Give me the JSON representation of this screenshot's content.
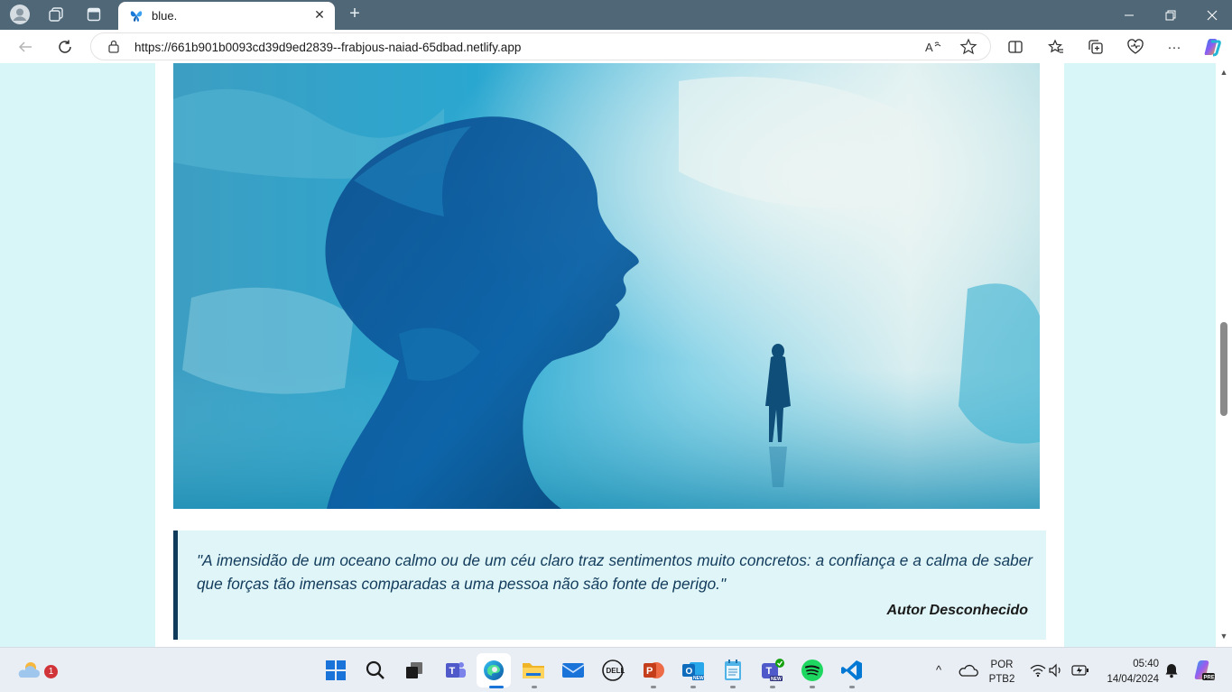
{
  "browser": {
    "tab": {
      "title": "blue.",
      "close": "✕"
    },
    "new_tab": "+",
    "window_controls": {
      "minimize": "—",
      "restore": "❐",
      "close": "✕"
    },
    "address": {
      "url": "https://661b901b0093cd39d9ed2839--frabjous-naiad-65dbad.netlify.app"
    },
    "nav": {
      "back": "←",
      "refresh": "↻",
      "more": "···"
    }
  },
  "page": {
    "hero_image": {
      "subject": "blue watercolor silhouette of a face with a small standing figure"
    },
    "quote": {
      "text": "\"A imensidão de um oceano calmo ou de um céu claro traz sentimentos muito concretos: a confiança e a calma de saber que forças tão imensas comparadas a uma pessoa não são fonte de perigo.\"",
      "author": "Autor Desconhecido"
    },
    "colors": {
      "page_bg": "#d8f5f7",
      "card_bg": "#ffffff",
      "quote_bg": "#dff5f7",
      "quote_border": "#0e3a5c",
      "quote_text": "#123b5c"
    }
  },
  "scrollbar": {
    "up": "▲",
    "down": "▼",
    "position": 0.48
  },
  "taskbar": {
    "weather_badge": "1",
    "apps": [
      "start",
      "search",
      "task-view",
      "teams",
      "edge",
      "file-explorer",
      "mail",
      "dell",
      "powerpoint",
      "outlook-new",
      "notepad",
      "teams-new",
      "spotify",
      "vscode"
    ],
    "tray": {
      "language_top": "POR",
      "language_bottom": "PTB2",
      "time": "05:40",
      "date": "14/04/2024",
      "chevron": "^"
    }
  }
}
